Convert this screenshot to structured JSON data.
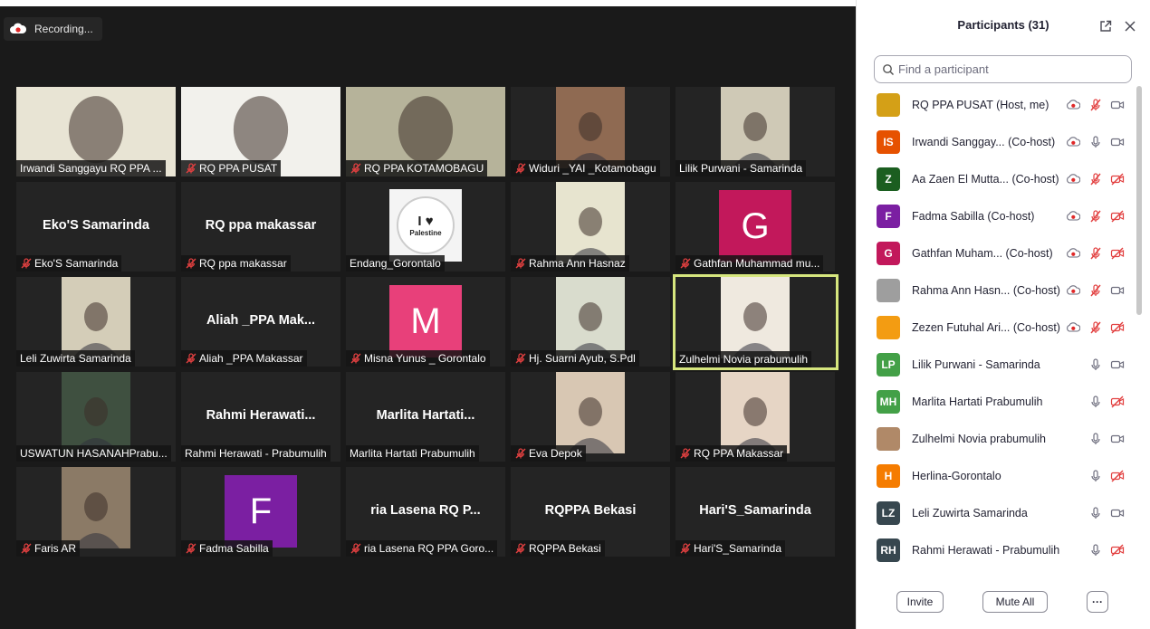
{
  "recording": {
    "label": "Recording..."
  },
  "tiles": [
    {
      "label": "Irwandi Sanggayu RQ PPA ...",
      "muted": false,
      "kind": "photo",
      "bg": "#e8e4d4"
    },
    {
      "label": "RQ PPA PUSAT",
      "muted": true,
      "kind": "photo",
      "bg": "#f2f1ec"
    },
    {
      "label": "RQ PPA KOTAMOBAGU",
      "muted": true,
      "kind": "photo",
      "bg": "#b6b39a"
    },
    {
      "label": "Widuri _YAI _Kotamobagu",
      "muted": true,
      "kind": "photo",
      "bg": "#8f6a52"
    },
    {
      "label": "Lilik Purwani - Samarinda",
      "muted": false,
      "kind": "photo",
      "bg": "#cfc9b6"
    },
    {
      "label": "Eko'S Samarinda",
      "muted": true,
      "kind": "name",
      "bigname": "Eko'S Samarinda"
    },
    {
      "label": "RQ ppa makassar",
      "muted": true,
      "kind": "name",
      "bigname": "RQ ppa makassar"
    },
    {
      "label": "Endang_Gorontalo",
      "muted": false,
      "kind": "logo",
      "bg": "#f4f4f4",
      "logo_text": "Palestine"
    },
    {
      "label": "Rahma Ann Hasnaz",
      "muted": true,
      "kind": "photo",
      "bg": "#e7e4cf"
    },
    {
      "label": "Gathfan Muhammad mu...",
      "muted": true,
      "kind": "avatar",
      "initial": "G",
      "color": "#c2185b"
    },
    {
      "label": "Leli Zuwirta Samarinda",
      "muted": false,
      "kind": "photo",
      "bg": "#d4cdb8"
    },
    {
      "label": "Aliah _PPA Makassar",
      "muted": true,
      "kind": "name",
      "bigname": "Aliah _PPA Mak..."
    },
    {
      "label": "Misna Yunus _ Gorontalo",
      "muted": true,
      "kind": "avatar",
      "initial": "M",
      "color": "#e8407a"
    },
    {
      "label": "Hj. Suarni Ayub, S.Pdl",
      "muted": true,
      "kind": "photo",
      "bg": "#d9dccd"
    },
    {
      "label": "Zulhelmi Novia prabumulih",
      "muted": false,
      "kind": "photo",
      "bg": "#efe9df",
      "active": true
    },
    {
      "label": "USWATUN HASANAHPrabu...",
      "muted": false,
      "kind": "photo",
      "bg": "#3f5040"
    },
    {
      "label": "Rahmi Herawati - Prabumulih",
      "muted": false,
      "kind": "name",
      "bigname": "Rahmi  Herawati..."
    },
    {
      "label": "Marlita Hartati Prabumulih",
      "muted": false,
      "kind": "name",
      "bigname": "Marlita  Hartati..."
    },
    {
      "label": "Eva Depok",
      "muted": true,
      "kind": "photo",
      "bg": "#d8c7b3"
    },
    {
      "label": "RQ PPA Makassar",
      "muted": true,
      "kind": "photo",
      "bg": "#e6d5c5"
    },
    {
      "label": "Faris AR",
      "muted": true,
      "kind": "photo",
      "bg": "#8b7a66"
    },
    {
      "label": "Fadma Sabilla",
      "muted": true,
      "kind": "avatar",
      "initial": "F",
      "color": "#7b1fa2"
    },
    {
      "label": "ria Lasena RQ PPA Goro...",
      "muted": true,
      "kind": "name",
      "bigname": "ria Lasena RQ P..."
    },
    {
      "label": "RQPPA Bekasi",
      "muted": true,
      "kind": "name",
      "bigname": "RQPPA Bekasi"
    },
    {
      "label": "Hari'S_Samarinda",
      "muted": true,
      "kind": "name",
      "bigname": "Hari'S_Samarinda"
    }
  ],
  "panel": {
    "title": "Participants (31)",
    "search_placeholder": "Find a participant",
    "invite_label": "Invite",
    "mute_all_label": "Mute All",
    "more_label": "···"
  },
  "participants": [
    {
      "name": "RQ PPA PUSAT (Host, me)",
      "avatar_text": "",
      "avatar_color": "#d4a017",
      "rec": true,
      "mic": "muted",
      "video": "on"
    },
    {
      "name": "Irwandi Sanggay...  (Co-host)",
      "avatar_text": "IS",
      "avatar_color": "#e65100",
      "rec": true,
      "mic": "on",
      "video": "on"
    },
    {
      "name": "Aa Zaen El Mutta...  (Co-host)",
      "avatar_text": "Z",
      "avatar_color": "#1b5e20",
      "rec": true,
      "mic": "muted",
      "video": "off"
    },
    {
      "name": "Fadma Sabilla (Co-host)",
      "avatar_text": "F",
      "avatar_color": "#7b1fa2",
      "rec": true,
      "mic": "muted",
      "video": "off"
    },
    {
      "name": "Gathfan Muham...  (Co-host)",
      "avatar_text": "G",
      "avatar_color": "#c2185b",
      "rec": true,
      "mic": "muted",
      "video": "off"
    },
    {
      "name": "Rahma Ann Hasn...  (Co-host)",
      "avatar_text": "",
      "avatar_color": "#9e9e9e",
      "rec": true,
      "mic": "muted",
      "video": "on"
    },
    {
      "name": "Zezen Futuhal Ari...  (Co-host)",
      "avatar_text": "",
      "avatar_color": "#f39c12",
      "rec": true,
      "mic": "muted",
      "video": "off"
    },
    {
      "name": "Lilik Purwani - Samarinda",
      "avatar_text": "LP",
      "avatar_color": "#43a047",
      "rec": false,
      "mic": "on",
      "video": "on"
    },
    {
      "name": "Marlita Hartati Prabumulih",
      "avatar_text": "MH",
      "avatar_color": "#43a047",
      "rec": false,
      "mic": "on",
      "video": "off"
    },
    {
      "name": "Zulhelmi Novia prabumulih",
      "avatar_text": "",
      "avatar_color": "#b08968",
      "rec": false,
      "mic": "on",
      "video": "on"
    },
    {
      "name": "Herlina-Gorontalo",
      "avatar_text": "H",
      "avatar_color": "#f57c00",
      "rec": false,
      "mic": "on",
      "video": "off"
    },
    {
      "name": "Leli Zuwirta Samarinda",
      "avatar_text": "LZ",
      "avatar_color": "#37474f",
      "rec": false,
      "mic": "on",
      "video": "on"
    },
    {
      "name": "Rahmi Herawati - Prabumulih",
      "avatar_text": "RH",
      "avatar_color": "#37474f",
      "rec": false,
      "mic": "on",
      "video": "off"
    }
  ]
}
